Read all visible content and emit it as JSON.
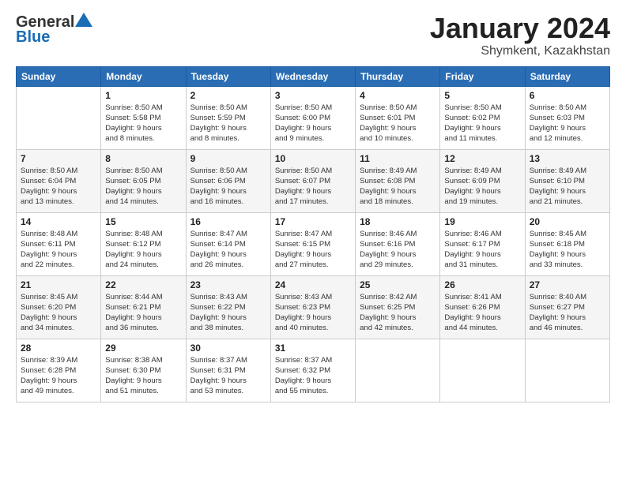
{
  "logo": {
    "general": "General",
    "blue": "Blue"
  },
  "title": {
    "month": "January 2024",
    "location": "Shymkent, Kazakhstan"
  },
  "headers": [
    "Sunday",
    "Monday",
    "Tuesday",
    "Wednesday",
    "Thursday",
    "Friday",
    "Saturday"
  ],
  "weeks": [
    [
      {
        "day": "",
        "info": ""
      },
      {
        "day": "1",
        "info": "Sunrise: 8:50 AM\nSunset: 5:58 PM\nDaylight: 9 hours\nand 8 minutes."
      },
      {
        "day": "2",
        "info": "Sunrise: 8:50 AM\nSunset: 5:59 PM\nDaylight: 9 hours\nand 8 minutes."
      },
      {
        "day": "3",
        "info": "Sunrise: 8:50 AM\nSunset: 6:00 PM\nDaylight: 9 hours\nand 9 minutes."
      },
      {
        "day": "4",
        "info": "Sunrise: 8:50 AM\nSunset: 6:01 PM\nDaylight: 9 hours\nand 10 minutes."
      },
      {
        "day": "5",
        "info": "Sunrise: 8:50 AM\nSunset: 6:02 PM\nDaylight: 9 hours\nand 11 minutes."
      },
      {
        "day": "6",
        "info": "Sunrise: 8:50 AM\nSunset: 6:03 PM\nDaylight: 9 hours\nand 12 minutes."
      }
    ],
    [
      {
        "day": "7",
        "info": "Sunrise: 8:50 AM\nSunset: 6:04 PM\nDaylight: 9 hours\nand 13 minutes."
      },
      {
        "day": "8",
        "info": "Sunrise: 8:50 AM\nSunset: 6:05 PM\nDaylight: 9 hours\nand 14 minutes."
      },
      {
        "day": "9",
        "info": "Sunrise: 8:50 AM\nSunset: 6:06 PM\nDaylight: 9 hours\nand 16 minutes."
      },
      {
        "day": "10",
        "info": "Sunrise: 8:50 AM\nSunset: 6:07 PM\nDaylight: 9 hours\nand 17 minutes."
      },
      {
        "day": "11",
        "info": "Sunrise: 8:49 AM\nSunset: 6:08 PM\nDaylight: 9 hours\nand 18 minutes."
      },
      {
        "day": "12",
        "info": "Sunrise: 8:49 AM\nSunset: 6:09 PM\nDaylight: 9 hours\nand 19 minutes."
      },
      {
        "day": "13",
        "info": "Sunrise: 8:49 AM\nSunset: 6:10 PM\nDaylight: 9 hours\nand 21 minutes."
      }
    ],
    [
      {
        "day": "14",
        "info": "Sunrise: 8:48 AM\nSunset: 6:11 PM\nDaylight: 9 hours\nand 22 minutes."
      },
      {
        "day": "15",
        "info": "Sunrise: 8:48 AM\nSunset: 6:12 PM\nDaylight: 9 hours\nand 24 minutes."
      },
      {
        "day": "16",
        "info": "Sunrise: 8:47 AM\nSunset: 6:14 PM\nDaylight: 9 hours\nand 26 minutes."
      },
      {
        "day": "17",
        "info": "Sunrise: 8:47 AM\nSunset: 6:15 PM\nDaylight: 9 hours\nand 27 minutes."
      },
      {
        "day": "18",
        "info": "Sunrise: 8:46 AM\nSunset: 6:16 PM\nDaylight: 9 hours\nand 29 minutes."
      },
      {
        "day": "19",
        "info": "Sunrise: 8:46 AM\nSunset: 6:17 PM\nDaylight: 9 hours\nand 31 minutes."
      },
      {
        "day": "20",
        "info": "Sunrise: 8:45 AM\nSunset: 6:18 PM\nDaylight: 9 hours\nand 33 minutes."
      }
    ],
    [
      {
        "day": "21",
        "info": "Sunrise: 8:45 AM\nSunset: 6:20 PM\nDaylight: 9 hours\nand 34 minutes."
      },
      {
        "day": "22",
        "info": "Sunrise: 8:44 AM\nSunset: 6:21 PM\nDaylight: 9 hours\nand 36 minutes."
      },
      {
        "day": "23",
        "info": "Sunrise: 8:43 AM\nSunset: 6:22 PM\nDaylight: 9 hours\nand 38 minutes."
      },
      {
        "day": "24",
        "info": "Sunrise: 8:43 AM\nSunset: 6:23 PM\nDaylight: 9 hours\nand 40 minutes."
      },
      {
        "day": "25",
        "info": "Sunrise: 8:42 AM\nSunset: 6:25 PM\nDaylight: 9 hours\nand 42 minutes."
      },
      {
        "day": "26",
        "info": "Sunrise: 8:41 AM\nSunset: 6:26 PM\nDaylight: 9 hours\nand 44 minutes."
      },
      {
        "day": "27",
        "info": "Sunrise: 8:40 AM\nSunset: 6:27 PM\nDaylight: 9 hours\nand 46 minutes."
      }
    ],
    [
      {
        "day": "28",
        "info": "Sunrise: 8:39 AM\nSunset: 6:28 PM\nDaylight: 9 hours\nand 49 minutes."
      },
      {
        "day": "29",
        "info": "Sunrise: 8:38 AM\nSunset: 6:30 PM\nDaylight: 9 hours\nand 51 minutes."
      },
      {
        "day": "30",
        "info": "Sunrise: 8:37 AM\nSunset: 6:31 PM\nDaylight: 9 hours\nand 53 minutes."
      },
      {
        "day": "31",
        "info": "Sunrise: 8:37 AM\nSunset: 6:32 PM\nDaylight: 9 hours\nand 55 minutes."
      },
      {
        "day": "",
        "info": ""
      },
      {
        "day": "",
        "info": ""
      },
      {
        "day": "",
        "info": ""
      }
    ]
  ]
}
